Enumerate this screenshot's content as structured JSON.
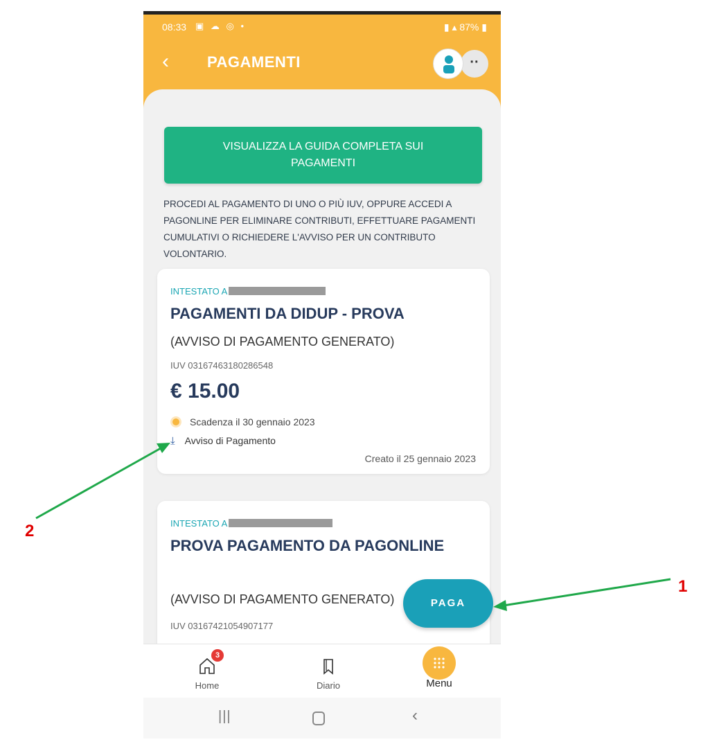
{
  "status_bar": {
    "time": "08:33",
    "battery": "87%"
  },
  "header": {
    "back_icon": "chevron-left-icon",
    "title": "PAGAMENTI",
    "more_icon": "dots-icon"
  },
  "guide_button": {
    "label": "VISUALIZZA LA GUIDA COMPLETA SUI PAGAMENTI"
  },
  "intro_text": "PROCEDI AL PAGAMENTO DI UNO O PIÙ IUV, OPPURE ACCEDI A PAGONLINE PER ELIMINARE CONTRIBUTI, EFFETTUARE PAGAMENTI CUMULATIVI O RICHIEDERE L'AVVISO PER UN CONTRIBUTO VOLONTARIO.",
  "cards": [
    {
      "intestato": "INTESTATO A",
      "title": "PAGAMENTI DA DIDUP - PROVA",
      "subtitle": "(AVVISO DI PAGAMENTO GENERATO)",
      "iuv": "IUV 03167463180286548",
      "amount": "€ 15.00",
      "deadline": "Scadenza il 30 gennaio 2023",
      "notice_link": "Avviso di Pagamento",
      "created": "Creato il 25 gennaio 2023"
    },
    {
      "intestato": "INTESTATO A",
      "title": "PROVA PAGAMENTO DA PAGONLINE",
      "subtitle": "(AVVISO DI PAGAMENTO GENERATO)",
      "iuv": "IUV 03167421054907177"
    }
  ],
  "fab": {
    "label": "PAGA"
  },
  "bottom_nav": {
    "home": {
      "label": "Home",
      "badge": "3",
      "icon": "home-icon"
    },
    "diario": {
      "label": "Diario",
      "icon": "bookmark-icon"
    },
    "menu": {
      "label": "Menu",
      "icon": "grid-dots-icon"
    }
  },
  "annotations": {
    "one": "1",
    "two": "2"
  },
  "colors": {
    "header": "#f8b73f",
    "guide_button": "#1fb383",
    "fab": "#1aa0b8",
    "title_text": "#273a5c",
    "annotation_arrow": "#1fa84a",
    "annotation_number": "#e00000"
  }
}
